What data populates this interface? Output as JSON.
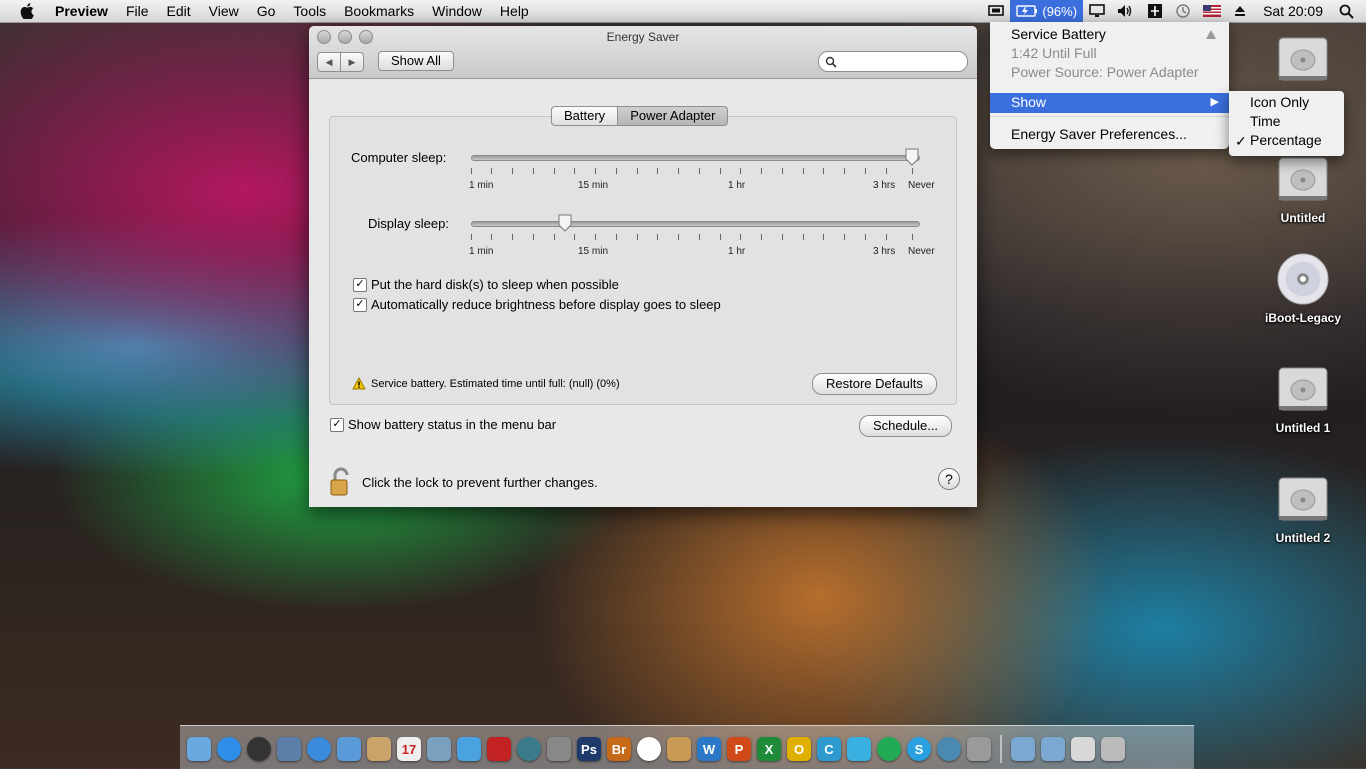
{
  "menubar": {
    "app": "Preview",
    "items": [
      "File",
      "Edit",
      "View",
      "Go",
      "Tools",
      "Bookmarks",
      "Window",
      "Help"
    ],
    "battery_percent": "(96%)",
    "clock": "Sat 20:09"
  },
  "window": {
    "title": "Energy Saver",
    "show_all": "Show All",
    "search_placeholder": "",
    "tabs": [
      "Battery",
      "Power Adapter"
    ],
    "selected_tab": "Power Adapter",
    "computer_sleep": {
      "label": "Computer sleep:",
      "value": "Never",
      "ticks": [
        "1 min",
        "15 min",
        "1 hr",
        "3 hrs",
        "Never"
      ]
    },
    "display_sleep": {
      "label": "Display sleep:",
      "value": "10 min",
      "ticks": [
        "1 min",
        "15 min",
        "1 hr",
        "3 hrs",
        "Never"
      ]
    },
    "checkbox_hard_disk": "Put the hard disk(s) to sleep when possible",
    "checkbox_brightness": "Automatically reduce brightness before display goes to sleep",
    "warning": "Service battery. Estimated time until full: (null) (0%)",
    "restore_defaults": "Restore Defaults",
    "checkbox_show_battery": "Show battery status in the menu bar",
    "schedule": "Schedule...",
    "lock_text": "Click the lock to prevent further changes.",
    "help": "?"
  },
  "battery_menu": {
    "service_battery": "Service Battery",
    "time_until_full": "1:42 Until Full",
    "power_source": "Power Source: Power Adapter",
    "show": "Show",
    "preferences": "Energy Saver Preferences...",
    "submenu": [
      "Icon Only",
      "Time",
      "Percentage"
    ],
    "submenu_checked": "Percentage"
  },
  "desktop_icons": [
    "",
    "Untitled",
    "iBoot-Legacy",
    "Untitled 1",
    "Untitled 2"
  ],
  "dock": {
    "apps": [
      "Finder",
      "App Store",
      "Dashboard",
      "Preview",
      "Safari",
      "FaceTime",
      "Contacts",
      "Calendar",
      "iPhoto",
      "iTunes",
      "Photo Booth",
      "Time Machine",
      "System Preferences",
      "Photoshop",
      "Bridge",
      "Chrome",
      "Archive Utility",
      "Word",
      "PowerPoint",
      "Excel",
      "Outlook",
      "Communicator",
      "Messenger",
      "Quicktime",
      "Skype",
      "Network",
      "Image Capture",
      "Applications",
      "Documents",
      "Downloads",
      "Trash"
    ],
    "colors": [
      "#6aa8e0",
      "#2f8fe8",
      "#333333",
      "#5b7fa8",
      "#3b8bdc",
      "#5a9ad8",
      "#c9a36a",
      "#eeeeee",
      "#7aa0c0",
      "#4aa3e0",
      "#c22222",
      "#3a7a8a",
      "#888888",
      "#1d3a6a",
      "#c66a1a",
      "#ffffff",
      "#c89a55",
      "#2b78c8",
      "#d04a1a",
      "#1f8a3a",
      "#e0b000",
      "#2d9ad0",
      "#3ab0e0",
      "#22aa55",
      "#2aa0e0",
      "#4a8ab0",
      "#9a9a9a",
      "#7aa8d0",
      "#7aa8d0",
      "#d8d8d8",
      "#bbbbbb"
    ],
    "labels": [
      "",
      "",
      "",
      "",
      "",
      "",
      "",
      "17",
      "",
      "",
      "",
      "",
      "",
      "Ps",
      "Br",
      "",
      "",
      "W",
      "P",
      "X",
      "O",
      "C",
      "",
      "",
      "S",
      "",
      "",
      "",
      "",
      "",
      ""
    ]
  }
}
